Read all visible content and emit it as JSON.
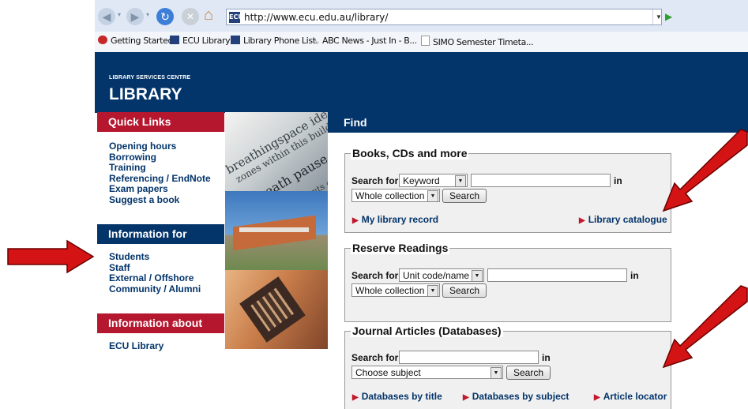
{
  "browser": {
    "url": "http://www.ecu.edu.au/library/",
    "favorites": [
      {
        "label": "Getting Started"
      },
      {
        "label": "ECU Library"
      },
      {
        "label": "Library Phone List"
      },
      {
        "label": "ABC News - Just In - B..."
      },
      {
        "label": "SIMO Semester Timeta..."
      }
    ]
  },
  "header": {
    "subtitle": "LIBRARY SERVICES CENTRE",
    "title": "LIBRARY"
  },
  "sidebar": {
    "quick_links_heading": "Quick Links",
    "quick_links": [
      "Opening hours",
      "Borrowing",
      "Training",
      "Referencing / EndNote",
      "Exam papers",
      "Suggest a book"
    ],
    "info_for_heading": "Information for",
    "info_for": [
      "Students",
      "Staff",
      "External / Offshore",
      "Community / Alumni"
    ],
    "info_about_heading": "Information about",
    "info_about": [
      "ECU Library"
    ]
  },
  "photos": {
    "photo1_words": [
      "breathingspace identity",
      "zones within this building",
      "inbreath pause and out",
      "residual fragments of these thoughts"
    ]
  },
  "find": {
    "heading": "Find",
    "books": {
      "title": "Books, CDs and more",
      "search_for_label": "Search for",
      "search_type": "Keyword",
      "in_label": "in",
      "scope": "Whole collection",
      "search_button": "Search",
      "link_left": "My library record",
      "link_right": "Library catalogue"
    },
    "reserve": {
      "title": "Reserve Readings",
      "search_for_label": "Search for",
      "search_type": "Unit code/name",
      "in_label": "in",
      "scope": "Whole collection",
      "search_button": "Search"
    },
    "journals": {
      "title": "Journal Articles (Databases)",
      "search_for_label": "Search for",
      "in_label": "in",
      "subject": "Choose subject",
      "search_button": "Search",
      "links": [
        "Databases by title",
        "Databases by subject",
        "Article locator"
      ]
    }
  },
  "colors": {
    "navy": "#03346a",
    "crimson": "#b5172f",
    "arrow_red": "#d41414"
  },
  "icons": {
    "back": "back-arrow-icon",
    "forward": "forward-arrow-icon",
    "refresh": "refresh-icon",
    "stop": "stop-icon",
    "home": "home-icon",
    "go": "go-play-icon"
  }
}
